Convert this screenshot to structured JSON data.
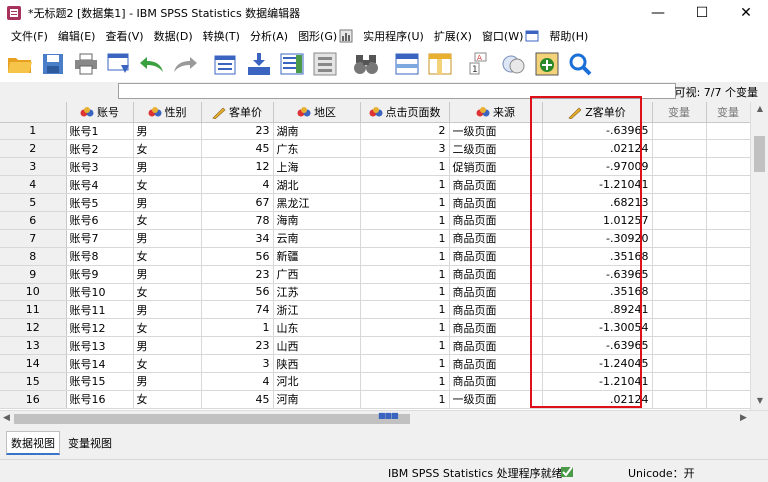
{
  "window": {
    "title": "*无标题2 [数据集1] - IBM SPSS Statistics 数据编辑器",
    "controls": {
      "minimize": "—",
      "maximize": "☐",
      "close": "✕"
    }
  },
  "menu": [
    {
      "label": "文件(F)"
    },
    {
      "label": "编辑(E)"
    },
    {
      "label": "查看(V)"
    },
    {
      "label": "数据(D)"
    },
    {
      "label": "转换(T)"
    },
    {
      "label": "分析(A)"
    },
    {
      "label": "图形(G)"
    },
    {
      "label": "实用程序(U)"
    },
    {
      "label": "扩展(X)"
    },
    {
      "label": "窗口(W)"
    },
    {
      "label": "帮助(H)"
    }
  ],
  "toolbar": {
    "icons": [
      "open-folder",
      "save",
      "print",
      "recall-dialog",
      "undo",
      "redo",
      "goto-case",
      "goto-variable",
      "variables",
      "find",
      "insert-cases",
      "insert-variable",
      "split-file",
      "weight-cases",
      "select-cases",
      "value-labels",
      "use-sets",
      "search"
    ]
  },
  "editor": {
    "value": "",
    "visible_vars": "可视: 7/7 个变量"
  },
  "grid": {
    "columns": [
      {
        "label": "账号",
        "icon": "nominal-icon"
      },
      {
        "label": "性别",
        "icon": "nominal-icon"
      },
      {
        "label": "客单价",
        "icon": "scale-icon"
      },
      {
        "label": "地区",
        "icon": "nominal-icon"
      },
      {
        "label": "点击页面数",
        "icon": "nominal-icon"
      },
      {
        "label": "来源",
        "icon": "nominal-icon"
      },
      {
        "label": "Z客单价",
        "icon": "scale-icon"
      },
      {
        "label": "变量",
        "icon": ""
      },
      {
        "label": "变量",
        "icon": ""
      }
    ],
    "rows": [
      {
        "n": "1",
        "c": [
          "账号1",
          "男",
          "23",
          "湖南",
          "2",
          "一级页面",
          "-.63965"
        ]
      },
      {
        "n": "2",
        "c": [
          "账号2",
          "女",
          "45",
          "广东",
          "3",
          "二级页面",
          ".02124"
        ]
      },
      {
        "n": "3",
        "c": [
          "账号3",
          "男",
          "12",
          "上海",
          "1",
          "促销页面",
          "-.97009"
        ]
      },
      {
        "n": "4",
        "c": [
          "账号4",
          "女",
          "4",
          "湖北",
          "1",
          "商品页面",
          "-1.21041"
        ]
      },
      {
        "n": "5",
        "c": [
          "账号5",
          "男",
          "67",
          "黑龙江",
          "1",
          "商品页面",
          ".68213"
        ]
      },
      {
        "n": "6",
        "c": [
          "账号6",
          "女",
          "78",
          "海南",
          "1",
          "商品页面",
          "1.01257"
        ]
      },
      {
        "n": "7",
        "c": [
          "账号7",
          "男",
          "34",
          "云南",
          "1",
          "商品页面",
          "-.30920"
        ]
      },
      {
        "n": "8",
        "c": [
          "账号8",
          "女",
          "56",
          "新疆",
          "1",
          "商品页面",
          ".35168"
        ]
      },
      {
        "n": "9",
        "c": [
          "账号9",
          "男",
          "23",
          "广西",
          "1",
          "商品页面",
          "-.63965"
        ]
      },
      {
        "n": "10",
        "c": [
          "账号10",
          "女",
          "56",
          "江苏",
          "1",
          "商品页面",
          ".35168"
        ]
      },
      {
        "n": "11",
        "c": [
          "账号11",
          "男",
          "74",
          "浙江",
          "1",
          "商品页面",
          ".89241"
        ]
      },
      {
        "n": "12",
        "c": [
          "账号12",
          "女",
          "1",
          "山东",
          "1",
          "商品页面",
          "-1.30054"
        ]
      },
      {
        "n": "13",
        "c": [
          "账号13",
          "男",
          "23",
          "山西",
          "1",
          "商品页面",
          "-.63965"
        ]
      },
      {
        "n": "14",
        "c": [
          "账号14",
          "女",
          "3",
          "陕西",
          "1",
          "商品页面",
          "-1.24045"
        ]
      },
      {
        "n": "15",
        "c": [
          "账号15",
          "男",
          "4",
          "河北",
          "1",
          "商品页面",
          "-1.21041"
        ]
      },
      {
        "n": "16",
        "c": [
          "账号16",
          "女",
          "45",
          "河南",
          "1",
          "一级页面",
          ".02124"
        ]
      }
    ]
  },
  "tabs": [
    {
      "label": "数据视图",
      "active": true
    },
    {
      "label": "变量视图",
      "active": false
    }
  ],
  "status": {
    "processor": "IBM SPSS Statistics 处理程序就绪",
    "encoding": "Unicode：开"
  },
  "colors": {
    "highlight": "#e0101a",
    "accent": "#3a74c8"
  }
}
